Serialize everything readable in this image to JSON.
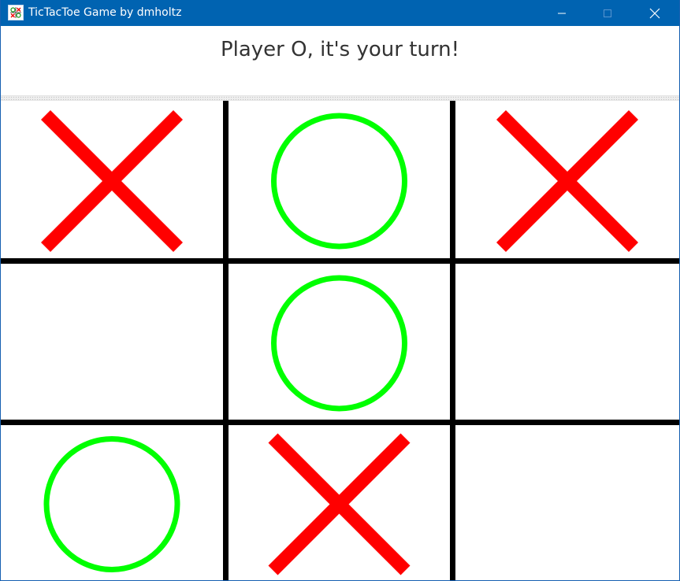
{
  "window": {
    "title": "TicTacToe Game by dmholtz",
    "icon": "tictactoe-app-icon",
    "controls": [
      "minimize-icon",
      "maximize-icon",
      "close-icon"
    ]
  },
  "status": {
    "message": "Player O, it's your turn!"
  },
  "board": {
    "cells": [
      [
        "X",
        "O",
        "X"
      ],
      [
        "",
        "O",
        ""
      ],
      [
        "O",
        "X",
        ""
      ]
    ]
  },
  "colors": {
    "titlebar": "#0063b1",
    "x_mark": "#ff0000",
    "o_mark": "#00ff00",
    "grid": "#000000",
    "status_text": "#333333"
  }
}
